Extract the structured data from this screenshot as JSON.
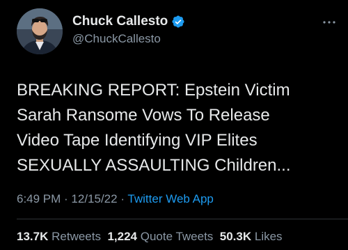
{
  "author": {
    "display_name": "Chuck Callesto",
    "handle": "@ChuckCallesto",
    "verified_icon": "verified-badge-icon",
    "avatar_icon": "avatar-photo"
  },
  "tweet": {
    "text": "BREAKING REPORT: Epstein Victim\nSarah Ransome Vows To Release\nVideo Tape Identifying VIP Elites\nSEXUALLY ASSAULTING Children...",
    "time": "6:49 PM",
    "sep1": " · ",
    "date": "12/15/22",
    "sep2": " · ",
    "source": "Twitter Web App"
  },
  "stats": {
    "retweets_count": "13.7K",
    "retweets_label": "Retweets",
    "quotes_count": "1,224",
    "quotes_label": "Quote Tweets",
    "likes_count": "50.3K",
    "likes_label": "Likes"
  },
  "colors": {
    "background": "#000000",
    "primary_text": "#e7e9ea",
    "secondary_text": "#8b98a5",
    "link": "#1d9bf0",
    "verified": "#1d9bf0"
  }
}
